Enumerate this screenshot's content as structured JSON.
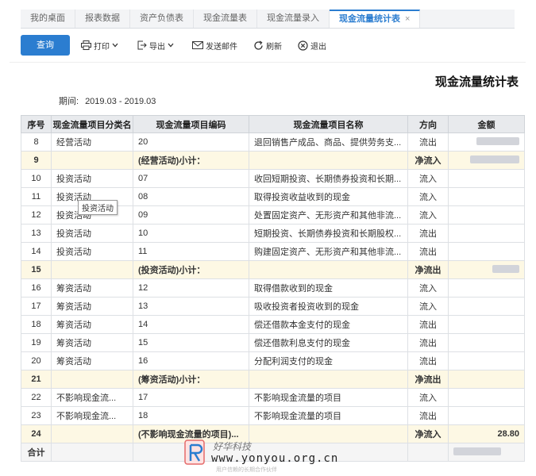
{
  "tabs": [
    {
      "label": "我的桌面",
      "active": false
    },
    {
      "label": "报表数据",
      "active": false
    },
    {
      "label": "资产负债表",
      "active": false
    },
    {
      "label": "现金流量表",
      "active": false
    },
    {
      "label": "现金流量录入",
      "active": false
    },
    {
      "label": "现金流量统计表",
      "active": true
    }
  ],
  "tab_close_glyph": "×",
  "toolbar": {
    "query": "查询",
    "print": "打印",
    "export": "导出",
    "send_email": "发送邮件",
    "refresh": "刷新",
    "exit": "退出"
  },
  "report": {
    "title": "现金流量统计表",
    "period_label": "期间:",
    "period_value": "2019.03 - 2019.03"
  },
  "table": {
    "headers": [
      "序号",
      "现金流量项目分类名",
      "现金流量项目编码",
      "现金流量项目名称",
      "方向",
      "金额"
    ],
    "rows": [
      {
        "no": "8",
        "cat": "经营活动",
        "code": "20",
        "name": "退回销售产成品、商品、提供劳务支...",
        "dir": "流出",
        "amount": "",
        "sub": false
      },
      {
        "no": "9",
        "cat": "",
        "code": "(经营活动)小计：",
        "name": "",
        "dir": "净流入",
        "amount": "",
        "sub": true
      },
      {
        "no": "10",
        "cat": "投资活动",
        "code": "07",
        "name": "收回短期投资、长期债券投资和长期...",
        "dir": "流入",
        "amount": "",
        "sub": false
      },
      {
        "no": "11",
        "cat": "投资活动",
        "code": "08",
        "name": "取得投资收益收到的现金",
        "dir": "流入",
        "amount": "",
        "sub": false
      },
      {
        "no": "12",
        "cat": "投资活动",
        "code": "09",
        "name": "处置固定资产、无形资产和其他非流...",
        "dir": "流入",
        "amount": "",
        "sub": false
      },
      {
        "no": "13",
        "cat": "投资活动",
        "code": "10",
        "name": "短期投资、长期债券投资和长期股权...",
        "dir": "流出",
        "amount": "",
        "sub": false
      },
      {
        "no": "14",
        "cat": "投资活动",
        "code": "11",
        "name": "购建固定资产、无形资产和其他非流...",
        "dir": "流出",
        "amount": "",
        "sub": false
      },
      {
        "no": "15",
        "cat": "",
        "code": "(投资活动)小计：",
        "name": "",
        "dir": "净流出",
        "amount": "",
        "sub": true
      },
      {
        "no": "16",
        "cat": "筹资活动",
        "code": "12",
        "name": "取得借款收到的现金",
        "dir": "流入",
        "amount": "",
        "sub": false
      },
      {
        "no": "17",
        "cat": "筹资活动",
        "code": "13",
        "name": "吸收投资者投资收到的现金",
        "dir": "流入",
        "amount": "",
        "sub": false
      },
      {
        "no": "18",
        "cat": "筹资活动",
        "code": "14",
        "name": "偿还借款本金支付的现金",
        "dir": "流出",
        "amount": "",
        "sub": false
      },
      {
        "no": "19",
        "cat": "筹资活动",
        "code": "15",
        "name": "偿还借款利息支付的现金",
        "dir": "流出",
        "amount": "",
        "sub": false
      },
      {
        "no": "20",
        "cat": "筹资活动",
        "code": "16",
        "name": "分配利润支付的现金",
        "dir": "流出",
        "amount": "",
        "sub": false
      },
      {
        "no": "21",
        "cat": "",
        "code": "(筹资活动)小计：",
        "name": "",
        "dir": "净流出",
        "amount": "",
        "sub": true
      },
      {
        "no": "22",
        "cat": "不影响现金流...",
        "code": "17",
        "name": "不影响现金流量的项目",
        "dir": "流入",
        "amount": "",
        "sub": false
      },
      {
        "no": "23",
        "cat": "不影响现金流...",
        "code": "18",
        "name": "不影响现金流量的项目",
        "dir": "流出",
        "amount": "",
        "sub": false
      },
      {
        "no": "24",
        "cat": "",
        "code": "(不影响现金流量的项目)...",
        "name": "",
        "dir": "净流入",
        "amount": "28.80",
        "sub": true
      }
    ],
    "total_label": "合计"
  },
  "tooltip": "投资活动",
  "watermark": {
    "brand": "好华科技",
    "url": "www.yonyou.org.cn",
    "tagline": "用户信赖的长期合作伙伴"
  }
}
